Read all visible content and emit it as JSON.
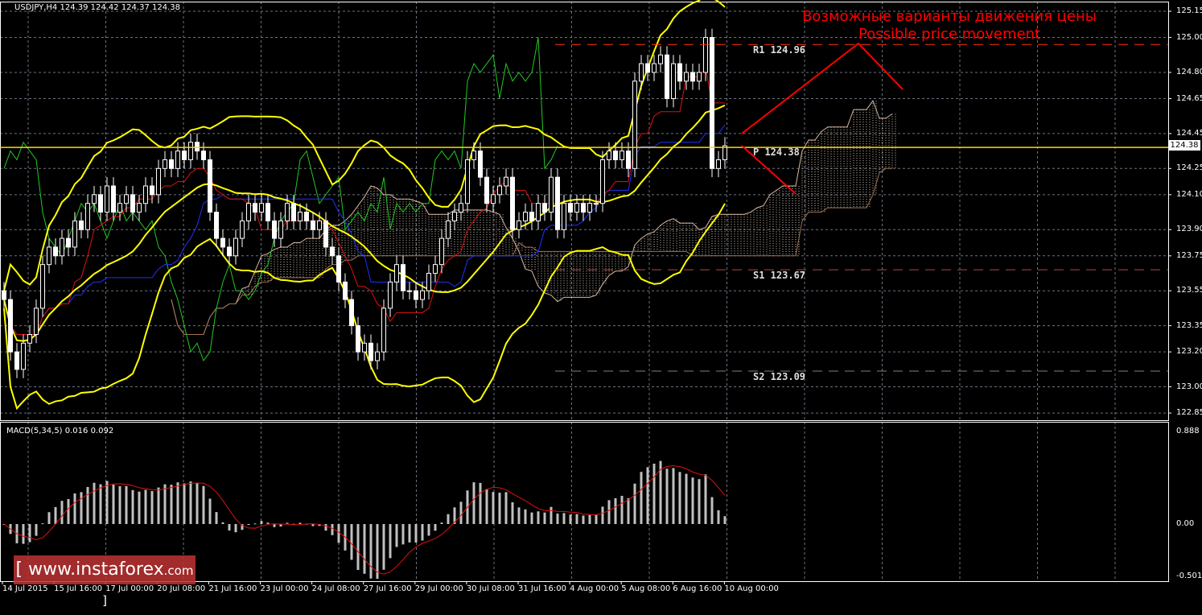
{
  "header": {
    "symbol_info": "USDJPY,H4  124.39 124.42 124.37 124.38"
  },
  "macd_label": "MACD(5,34,5) 0.016 0.092",
  "annotation": {
    "line1": "Возможные варианты движения цены",
    "line2": "Possible price movement"
  },
  "pivots": [
    {
      "name": "R1",
      "label": "R1 124.96",
      "value": 124.96,
      "color": "#ff3300"
    },
    {
      "name": "P",
      "label": "P 124.38",
      "value": 124.38,
      "color": "#ffd700"
    },
    {
      "name": "S1",
      "label": "S1 123.67",
      "value": 123.67,
      "color": "#a05040"
    },
    {
      "name": "S2",
      "label": "S2 123.09",
      "value": 123.09,
      "color": "#808080"
    }
  ],
  "current_price": "124.38",
  "logo": {
    "text": "[ www.instaforex",
    "suffix": ".com ]"
  },
  "chart_data": {
    "type": "candlestick",
    "title": "USDJPY,H4",
    "price_axis": {
      "ticks": [
        "125.15",
        "125.00",
        "124.80",
        "124.65",
        "124.45",
        "124.25",
        "124.10",
        "123.90",
        "123.75",
        "123.55",
        "123.35",
        "123.20",
        "123.00",
        "122.85"
      ],
      "ylim": [
        122.85,
        125.15
      ]
    },
    "macd_axis": {
      "ticks": [
        "0.888",
        "0.00",
        "-0.501"
      ],
      "ylim": [
        -0.501,
        0.888
      ]
    },
    "time_axis": [
      "14 Jul 2015",
      "15 Jul 16:00",
      "17 Jul 00:00",
      "20 Jul 08:00",
      "21 Jul 16:00",
      "23 Jul 00:00",
      "24 Jul 08:00",
      "27 Jul 16:00",
      "29 Jul 00:00",
      "30 Jul 08:00",
      "31 Jul 16:00",
      "4 Aug 00:00",
      "5 Aug 08:00",
      "6 Aug 16:00",
      "10 Aug 00:00"
    ],
    "closes": [
      123.5,
      123.2,
      123.1,
      123.25,
      123.3,
      123.45,
      123.7,
      123.8,
      123.75,
      123.85,
      123.8,
      123.95,
      123.9,
      124.05,
      124.1,
      124.0,
      124.15,
      124.0,
      124.05,
      124.1,
      124.0,
      124.05,
      124.15,
      124.1,
      124.25,
      124.3,
      124.25,
      124.35,
      124.3,
      124.4,
      124.35,
      124.3,
      124.0,
      123.85,
      123.8,
      123.75,
      123.85,
      123.95,
      124.05,
      124.0,
      124.05,
      123.95,
      123.85,
      123.95,
      124.05,
      123.95,
      124.0,
      123.95,
      123.9,
      123.95,
      123.8,
      123.75,
      123.6,
      123.5,
      123.35,
      123.2,
      123.25,
      123.15,
      123.2,
      123.45,
      123.6,
      123.7,
      123.55,
      123.55,
      123.5,
      123.55,
      123.65,
      123.7,
      123.85,
      123.95,
      124.0,
      124.05,
      124.3,
      124.35,
      124.2,
      124.05,
      124.1,
      124.15,
      124.2,
      123.9,
      123.95,
      124.0,
      123.95,
      124.05,
      124.0,
      124.2,
      123.9,
      124.05,
      124.0,
      124.05,
      124.0,
      124.05,
      124.05,
      124.3,
      124.35,
      124.3,
      124.35,
      124.25,
      124.75,
      124.85,
      124.8,
      124.85,
      124.9,
      124.65,
      124.85,
      124.75,
      124.8,
      124.75,
      124.8,
      125.0,
      124.25,
      124.3,
      124.38
    ],
    "indicators": [
      "Bollinger Bands",
      "Ichimoku",
      "MACD(5,34,5)"
    ],
    "forecast": [
      {
        "from": 124.45,
        "to": 124.96,
        "then": 124.7
      },
      {
        "from": 124.38,
        "to": 124.1
      }
    ]
  }
}
